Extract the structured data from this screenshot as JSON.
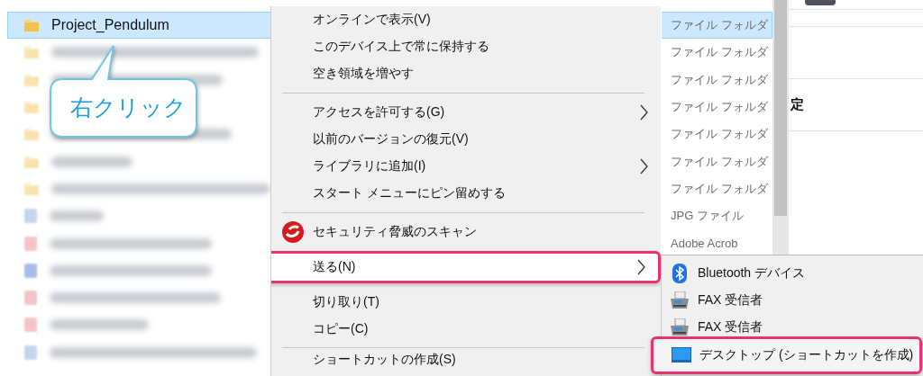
{
  "file_list": {
    "rows": [
      {
        "kind": "folder",
        "name": "Project_Pendulum",
        "selected": true
      },
      {
        "kind": "folder",
        "selected": false
      },
      {
        "kind": "folder",
        "selected": false
      },
      {
        "kind": "folder",
        "selected": false
      },
      {
        "kind": "folder",
        "selected": false
      },
      {
        "kind": "folder",
        "selected": false
      },
      {
        "kind": "folder",
        "selected": false
      },
      {
        "kind": "image",
        "selected": false
      },
      {
        "kind": "pdf",
        "selected": false
      },
      {
        "kind": "doc",
        "selected": false
      },
      {
        "kind": "pdf",
        "selected": false
      },
      {
        "kind": "pdf",
        "selected": false
      },
      {
        "kind": "image",
        "selected": false
      }
    ]
  },
  "type_column": [
    {
      "text": "ファイル フォルダ",
      "selected": true
    },
    {
      "text": "ファイル フォルダ",
      "selected": false
    },
    {
      "text": "ファイル フォルダ",
      "selected": false
    },
    {
      "text": "ファイル フォルダ",
      "selected": false
    },
    {
      "text": "ファイル フォルダ",
      "selected": false
    },
    {
      "text": "ファイル フォルダ",
      "selected": false
    },
    {
      "text": "ファイル フォルダ",
      "selected": false
    },
    {
      "text": "JPG ファイル",
      "selected": false
    },
    {
      "text": "Adobe Acrob",
      "selected": false
    }
  ],
  "details_pane": {
    "text": "定"
  },
  "context_menu": [
    {
      "kind": "item",
      "label": "オンラインで表示(V)",
      "submenu": false,
      "highlighted": false
    },
    {
      "kind": "item",
      "label": "このデバイス上で常に保持する",
      "submenu": false,
      "highlighted": false
    },
    {
      "kind": "item",
      "label": "空き領域を増やす",
      "submenu": false,
      "highlighted": false
    },
    {
      "kind": "separator"
    },
    {
      "kind": "item",
      "label": "アクセスを許可する(G)",
      "submenu": true,
      "highlighted": false
    },
    {
      "kind": "item",
      "label": "以前のバージョンの復元(V)",
      "submenu": false,
      "highlighted": false
    },
    {
      "kind": "item",
      "label": "ライブラリに追加(I)",
      "submenu": true,
      "highlighted": false
    },
    {
      "kind": "item",
      "label": "スタート メニューにピン留めする",
      "submenu": false,
      "highlighted": false
    },
    {
      "kind": "separator"
    },
    {
      "kind": "scan_item",
      "label": "セキュリティ脅威のスキャン",
      "submenu": false,
      "highlighted": false
    },
    {
      "kind": "item",
      "label": "送る(N)",
      "submenu": true,
      "highlighted": true
    },
    {
      "kind": "item",
      "label": "切り取り(T)",
      "submenu": false,
      "highlighted": false
    },
    {
      "kind": "item",
      "label": "コピー(C)",
      "submenu": false,
      "highlighted": false
    },
    {
      "kind": "separator"
    },
    {
      "kind": "item",
      "label": "ショートカットの作成(S)",
      "submenu": false,
      "highlighted": false
    }
  ],
  "send_to_menu": [
    {
      "kind": "bluetooth",
      "label": "Bluetooth デバイス",
      "highlighted": false
    },
    {
      "kind": "fax",
      "label": "FAX 受信者",
      "highlighted": false
    },
    {
      "kind": "fax",
      "label": "FAX 受信者",
      "highlighted": false
    },
    {
      "kind": "desktop",
      "label": "デスクトップ (ショートカットを作成)",
      "highlighted": true
    }
  ],
  "callout": {
    "text": "右クリック"
  }
}
